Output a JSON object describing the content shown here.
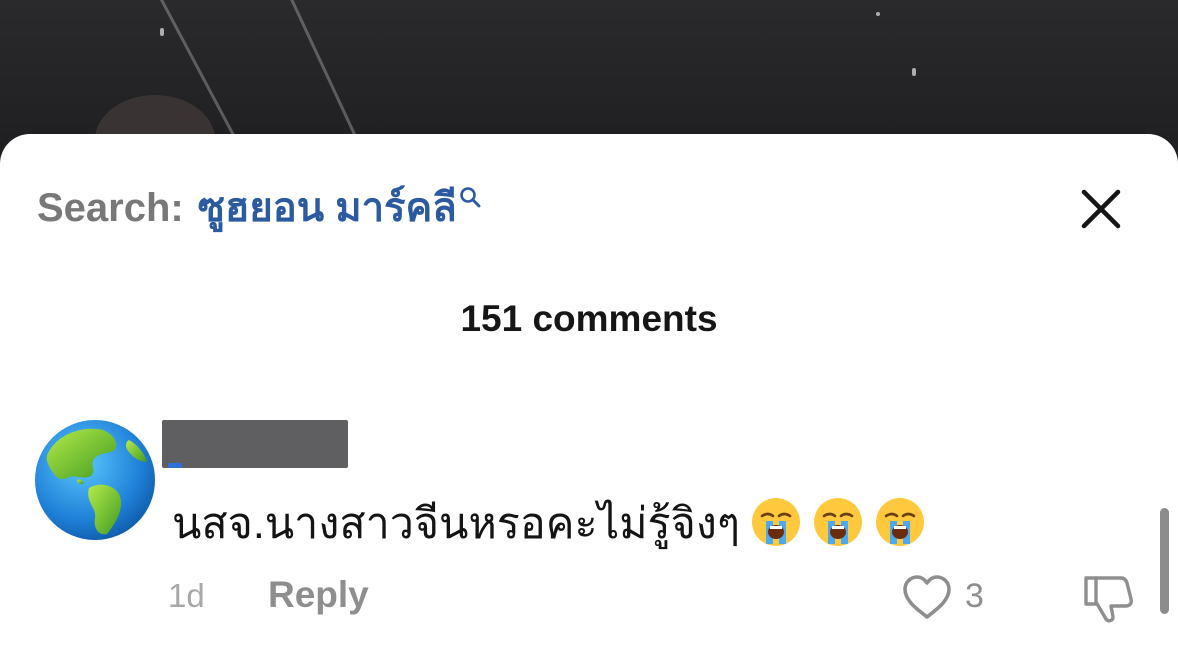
{
  "header": {
    "search_prefix": "Search:",
    "search_query": "ซูฮยอน มาร์คลี",
    "search_icon": "search-icon",
    "close_icon": "close-icon"
  },
  "comments_count_label": "151 comments",
  "comment": {
    "avatar_icon": "globe-americas-emoji",
    "username_redacted": true,
    "text": "นสจ.นางสาวจีนหรอคะไม่รู้จิงๆ",
    "emojis": [
      "loudly-crying-face-emoji",
      "loudly-crying-face-emoji",
      "loudly-crying-face-emoji"
    ],
    "time": "1d",
    "reply_label": "Reply",
    "like_count": "3",
    "like_icon": "heart-outline-icon",
    "dislike_icon": "thumbs-down-icon"
  },
  "colors": {
    "search_query": "#2c5aa0",
    "search_prefix": "#787878",
    "meta_text": "#8e8e8e",
    "sheet_background": "#ffffff"
  }
}
